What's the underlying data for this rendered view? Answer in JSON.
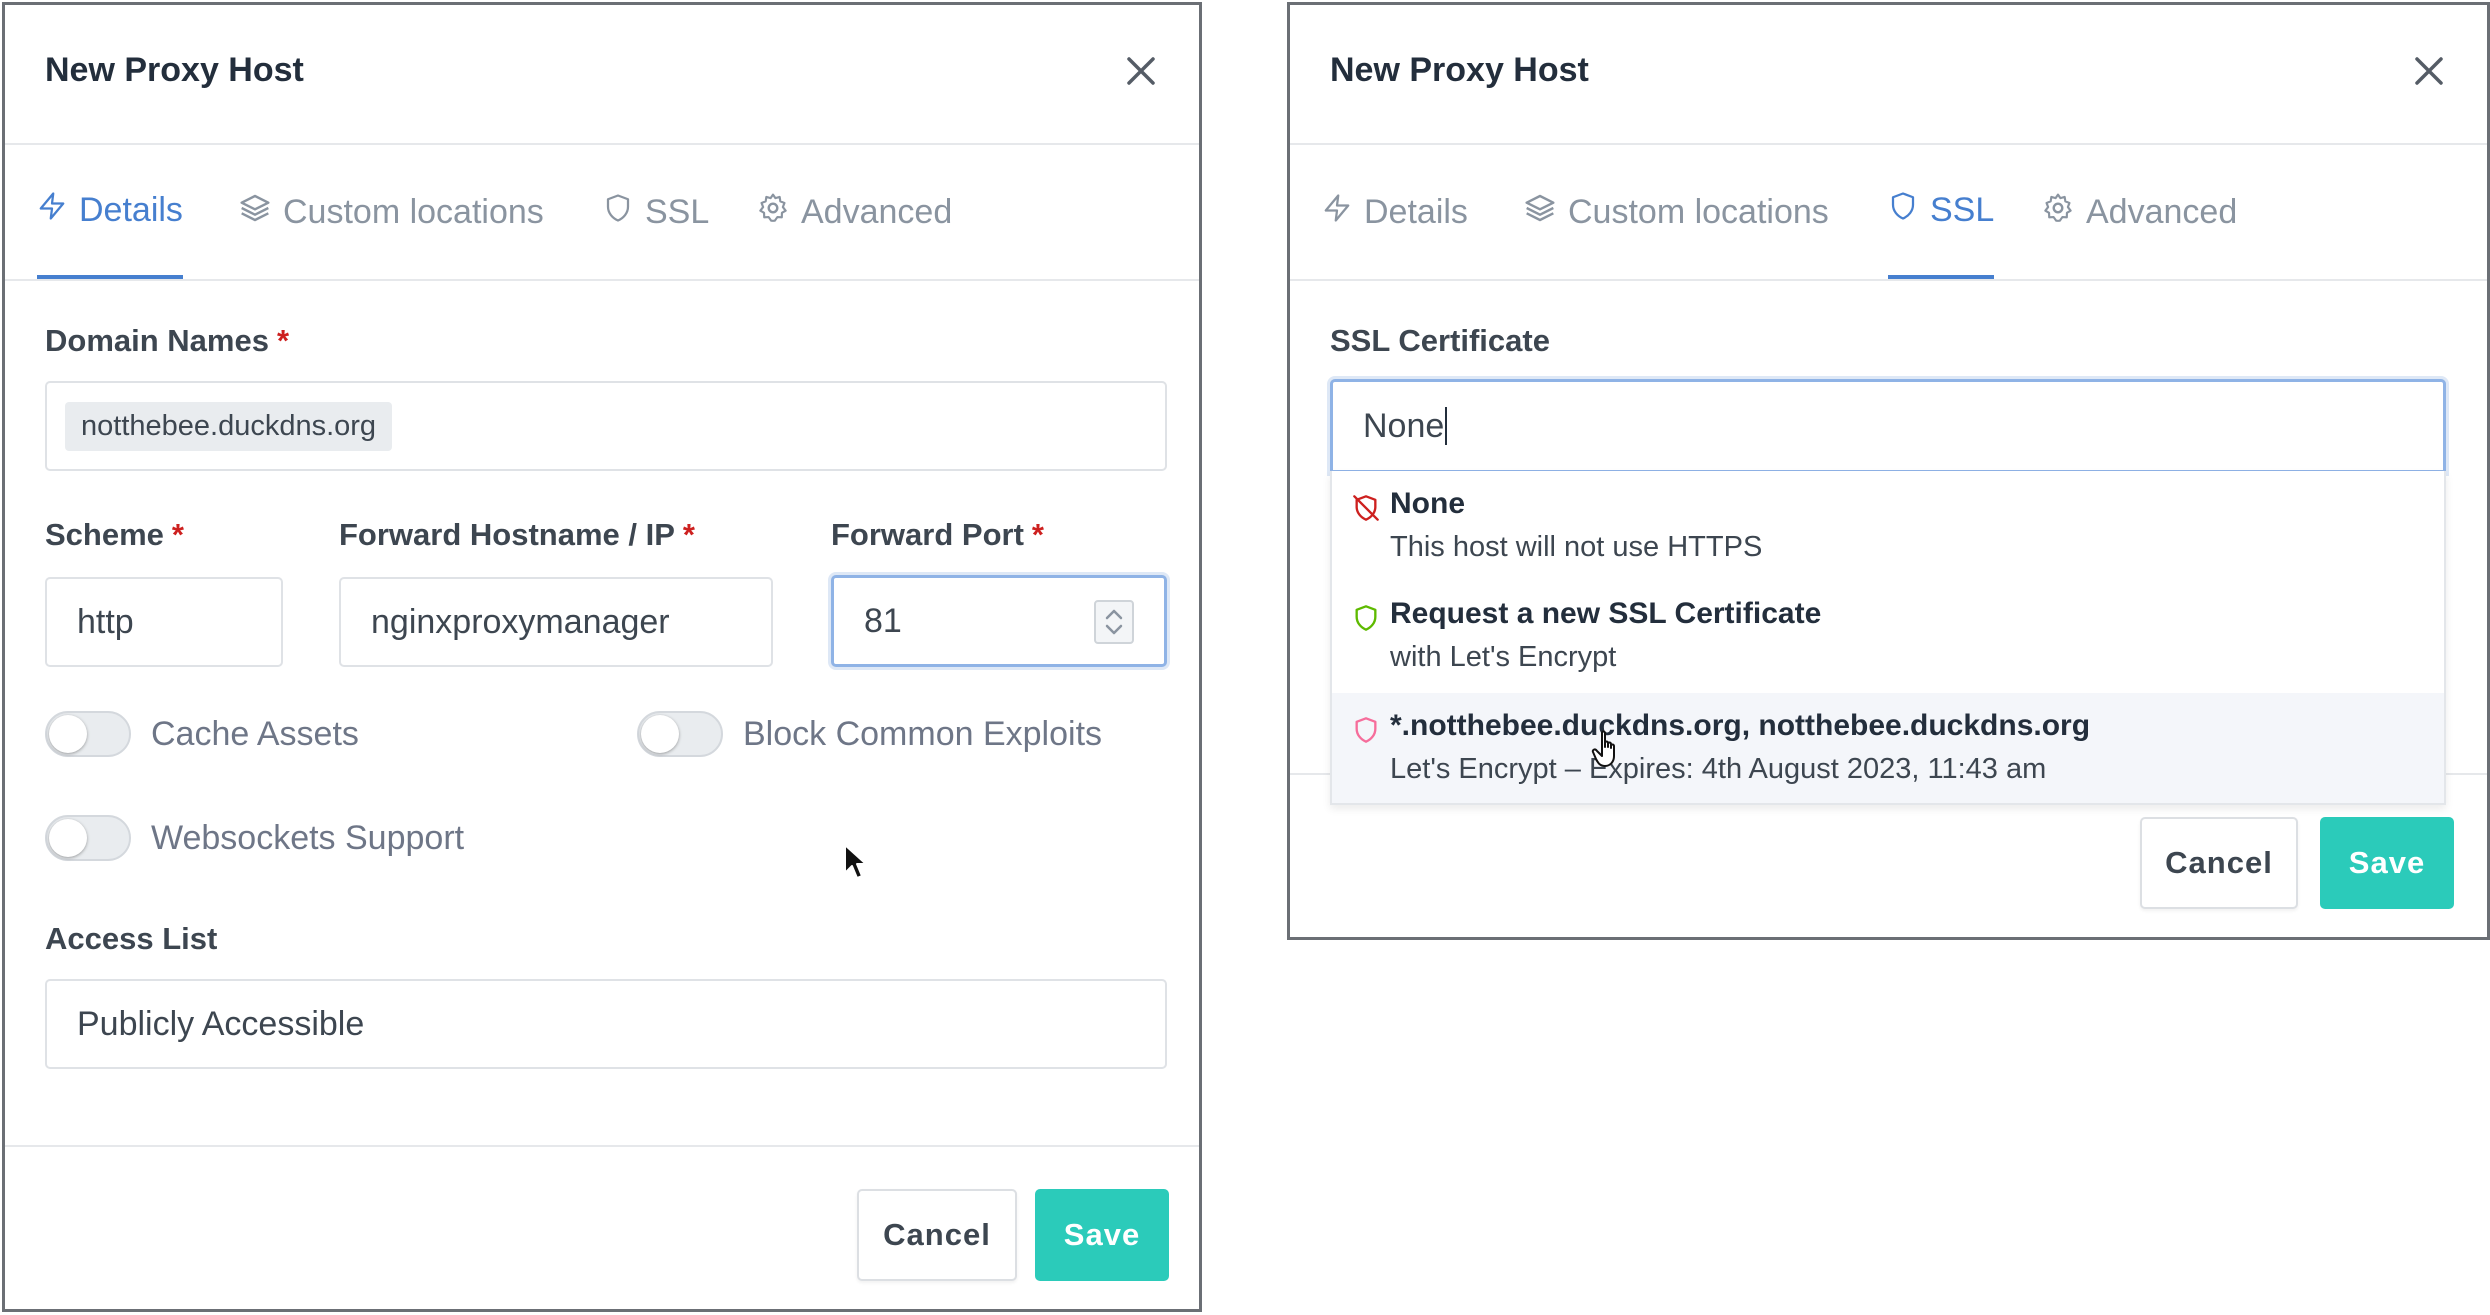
{
  "left_modal": {
    "title": "New Proxy Host",
    "tabs": [
      {
        "label": "Details",
        "icon": "bolt-icon",
        "active": true
      },
      {
        "label": "Custom locations",
        "icon": "layers-icon",
        "active": false
      },
      {
        "label": "SSL",
        "icon": "shield-icon",
        "active": false
      },
      {
        "label": "Advanced",
        "icon": "gear-icon",
        "active": false
      }
    ],
    "domain_names": {
      "label": "Domain Names",
      "required": "*",
      "chip": "notthebee.duckdns.org"
    },
    "scheme": {
      "label": "Scheme",
      "required": "*",
      "value": "http"
    },
    "forward_hostname": {
      "label": "Forward Hostname / IP",
      "required": "*",
      "value": "nginxproxymanager"
    },
    "forward_port": {
      "label": "Forward Port",
      "required": "*",
      "value": "81"
    },
    "toggles": [
      {
        "label": "Cache Assets",
        "on": false
      },
      {
        "label": "Block Common Exploits",
        "on": false
      },
      {
        "label": "Websockets Support",
        "on": false
      }
    ],
    "access_list": {
      "label": "Access List",
      "value": "Publicly Accessible"
    },
    "cancel_label": "Cancel",
    "save_label": "Save"
  },
  "right_modal": {
    "title": "New Proxy Host",
    "tabs": [
      {
        "label": "Details",
        "icon": "bolt-icon",
        "active": false
      },
      {
        "label": "Custom locations",
        "icon": "layers-icon",
        "active": false
      },
      {
        "label": "SSL",
        "icon": "shield-icon",
        "active": true
      },
      {
        "label": "Advanced",
        "icon": "gear-icon",
        "active": false
      }
    ],
    "ssl_certificate": {
      "label": "SSL Certificate",
      "value": "None"
    },
    "options": [
      {
        "title": "None",
        "subtitle": "This host will not use HTTPS",
        "icon": "shield-off-icon",
        "color": "#cd201f"
      },
      {
        "title": "Request a new SSL Certificate",
        "subtitle": "with Let's Encrypt",
        "icon": "shield-icon",
        "color": "#5eba00"
      },
      {
        "title": "*.notthebee.duckdns.org, notthebee.duckdns.org",
        "subtitle": "Let's Encrypt – Expires: 4th August 2023, 11:43 am",
        "icon": "shield-icon",
        "color": "#f66d9b"
      }
    ],
    "cancel_label": "Cancel",
    "save_label": "Save"
  },
  "colors": {
    "accent": "#467fcf",
    "save": "#2bcbba",
    "required": "#cd201f"
  }
}
